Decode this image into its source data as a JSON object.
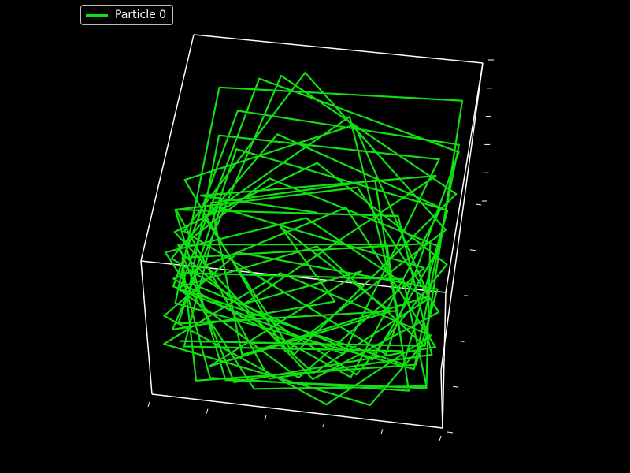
{
  "chart_data": {
    "type": "line",
    "projection": "3d",
    "background_color": "#000000",
    "axis_color": "#ffffff",
    "grid": false,
    "legend_placement": "top-left",
    "xlim": [
      0,
      1
    ],
    "ylim": [
      0,
      1
    ],
    "zlim": [
      0,
      1
    ],
    "series": [
      {
        "name": "Particle 0",
        "color": "#13e013",
        "points": [
          [
            0.08,
            0.06,
            0.92
          ],
          [
            0.93,
            0.1,
            0.9
          ],
          [
            0.95,
            0.96,
            0.88
          ],
          [
            0.12,
            0.94,
            0.86
          ],
          [
            0.05,
            0.2,
            0.85
          ],
          [
            0.9,
            0.04,
            0.8
          ],
          [
            0.96,
            0.88,
            0.78
          ],
          [
            0.2,
            0.95,
            0.75
          ],
          [
            0.04,
            0.3,
            0.72
          ],
          [
            0.86,
            0.08,
            0.7
          ],
          [
            0.95,
            0.7,
            0.68
          ],
          [
            0.35,
            0.96,
            0.65
          ],
          [
            0.03,
            0.45,
            0.62
          ],
          [
            0.7,
            0.05,
            0.6
          ],
          [
            0.97,
            0.55,
            0.58
          ],
          [
            0.5,
            0.95,
            0.55
          ],
          [
            0.04,
            0.62,
            0.52
          ],
          [
            0.55,
            0.04,
            0.5
          ],
          [
            0.96,
            0.4,
            0.48
          ],
          [
            0.65,
            0.96,
            0.45
          ],
          [
            0.05,
            0.8,
            0.42
          ],
          [
            0.4,
            0.05,
            0.4
          ],
          [
            0.95,
            0.25,
            0.38
          ],
          [
            0.8,
            0.95,
            0.35
          ],
          [
            0.06,
            0.9,
            0.32
          ],
          [
            0.25,
            0.05,
            0.3
          ],
          [
            0.94,
            0.12,
            0.28
          ],
          [
            0.92,
            0.94,
            0.25
          ],
          [
            0.1,
            0.75,
            0.22
          ],
          [
            0.15,
            0.06,
            0.2
          ],
          [
            0.9,
            0.3,
            0.18
          ],
          [
            0.96,
            0.8,
            0.15
          ],
          [
            0.3,
            0.94,
            0.12
          ],
          [
            0.05,
            0.5,
            0.1
          ],
          [
            0.6,
            0.04,
            0.08
          ],
          [
            0.95,
            0.6,
            0.06
          ],
          [
            0.45,
            0.95,
            0.04
          ],
          [
            0.05,
            0.35,
            0.05
          ],
          [
            0.75,
            0.06,
            0.1
          ],
          [
            0.92,
            0.45,
            0.15
          ],
          [
            0.55,
            0.92,
            0.2
          ],
          [
            0.08,
            0.55,
            0.25
          ],
          [
            0.5,
            0.1,
            0.3
          ],
          [
            0.9,
            0.7,
            0.35
          ],
          [
            0.2,
            0.85,
            0.4
          ],
          [
            0.1,
            0.15,
            0.45
          ],
          [
            0.85,
            0.2,
            0.5
          ],
          [
            0.7,
            0.9,
            0.55
          ],
          [
            0.15,
            0.7,
            0.6
          ],
          [
            0.3,
            0.08,
            0.65
          ],
          [
            0.92,
            0.35,
            0.7
          ],
          [
            0.6,
            0.94,
            0.75
          ],
          [
            0.04,
            0.65,
            0.8
          ],
          [
            0.45,
            0.06,
            0.85
          ],
          [
            0.95,
            0.5,
            0.9
          ],
          [
            0.4,
            0.95,
            0.95
          ],
          [
            0.05,
            0.4,
            0.97
          ],
          [
            0.8,
            0.05,
            0.96
          ],
          [
            0.96,
            0.75,
            0.93
          ],
          [
            0.25,
            0.96,
            0.89
          ],
          [
            0.06,
            0.25,
            0.84
          ],
          [
            0.65,
            0.08,
            0.79
          ],
          [
            0.9,
            0.85,
            0.74
          ],
          [
            0.15,
            0.9,
            0.69
          ],
          [
            0.1,
            0.35,
            0.64
          ],
          [
            0.75,
            0.12,
            0.59
          ],
          [
            0.94,
            0.65,
            0.54
          ],
          [
            0.35,
            0.92,
            0.49
          ],
          [
            0.06,
            0.6,
            0.44
          ],
          [
            0.55,
            0.1,
            0.39
          ],
          [
            0.92,
            0.55,
            0.34
          ],
          [
            0.5,
            0.96,
            0.29
          ],
          [
            0.04,
            0.75,
            0.24
          ],
          [
            0.35,
            0.05,
            0.19
          ],
          [
            0.94,
            0.2,
            0.14
          ],
          [
            0.85,
            0.92,
            0.09
          ],
          [
            0.12,
            0.85,
            0.06
          ],
          [
            0.2,
            0.12,
            0.11
          ],
          [
            0.88,
            0.15,
            0.16
          ],
          [
            0.78,
            0.96,
            0.21
          ],
          [
            0.08,
            0.78,
            0.26
          ],
          [
            0.28,
            0.04,
            0.31
          ],
          [
            0.96,
            0.3,
            0.36
          ],
          [
            0.62,
            0.9,
            0.41
          ],
          [
            0.05,
            0.45,
            0.46
          ],
          [
            0.68,
            0.06,
            0.51
          ],
          [
            0.93,
            0.8,
            0.56
          ],
          [
            0.22,
            0.92,
            0.61
          ],
          [
            0.07,
            0.18,
            0.66
          ],
          [
            0.82,
            0.28,
            0.71
          ],
          [
            0.58,
            0.96,
            0.76
          ],
          [
            0.12,
            0.52,
            0.81
          ],
          [
            0.48,
            0.05,
            0.86
          ],
          [
            0.97,
            0.62,
            0.91
          ],
          [
            0.32,
            0.94,
            0.94
          ],
          [
            0.05,
            0.1,
            0.9
          ],
          [
            0.6,
            0.3,
            0.7
          ],
          [
            0.4,
            0.7,
            0.5
          ],
          [
            0.8,
            0.5,
            0.3
          ],
          [
            0.2,
            0.2,
            0.1
          ],
          [
            0.7,
            0.8,
            0.2
          ],
          [
            0.3,
            0.4,
            0.4
          ],
          [
            0.9,
            0.9,
            0.6
          ],
          [
            0.1,
            0.6,
            0.8
          ],
          [
            0.5,
            0.5,
            0.95
          ]
        ]
      }
    ]
  }
}
